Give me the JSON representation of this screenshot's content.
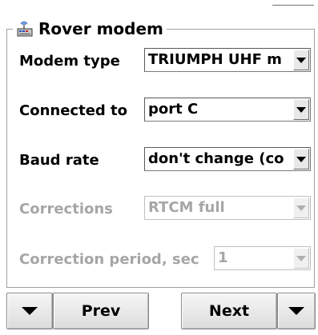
{
  "groupbox": {
    "icon": "modem-icon",
    "title": "Rover modem"
  },
  "fields": [
    {
      "label": "Modem type",
      "value": "TRIUMPH UHF m",
      "enabled": true
    },
    {
      "label": "Connected to",
      "value": "port C",
      "enabled": true
    },
    {
      "label": "Baud rate",
      "value": "don't change (co",
      "enabled": true
    },
    {
      "label": "Corrections",
      "value": "RTCM full",
      "enabled": false
    },
    {
      "label": "Correction period, sec",
      "value": "1",
      "enabled": false
    }
  ],
  "footer": {
    "left_menu_icon": "triangle-down-icon",
    "prev_label": "Prev",
    "next_label": "Next",
    "right_menu_icon": "triangle-down-icon"
  }
}
